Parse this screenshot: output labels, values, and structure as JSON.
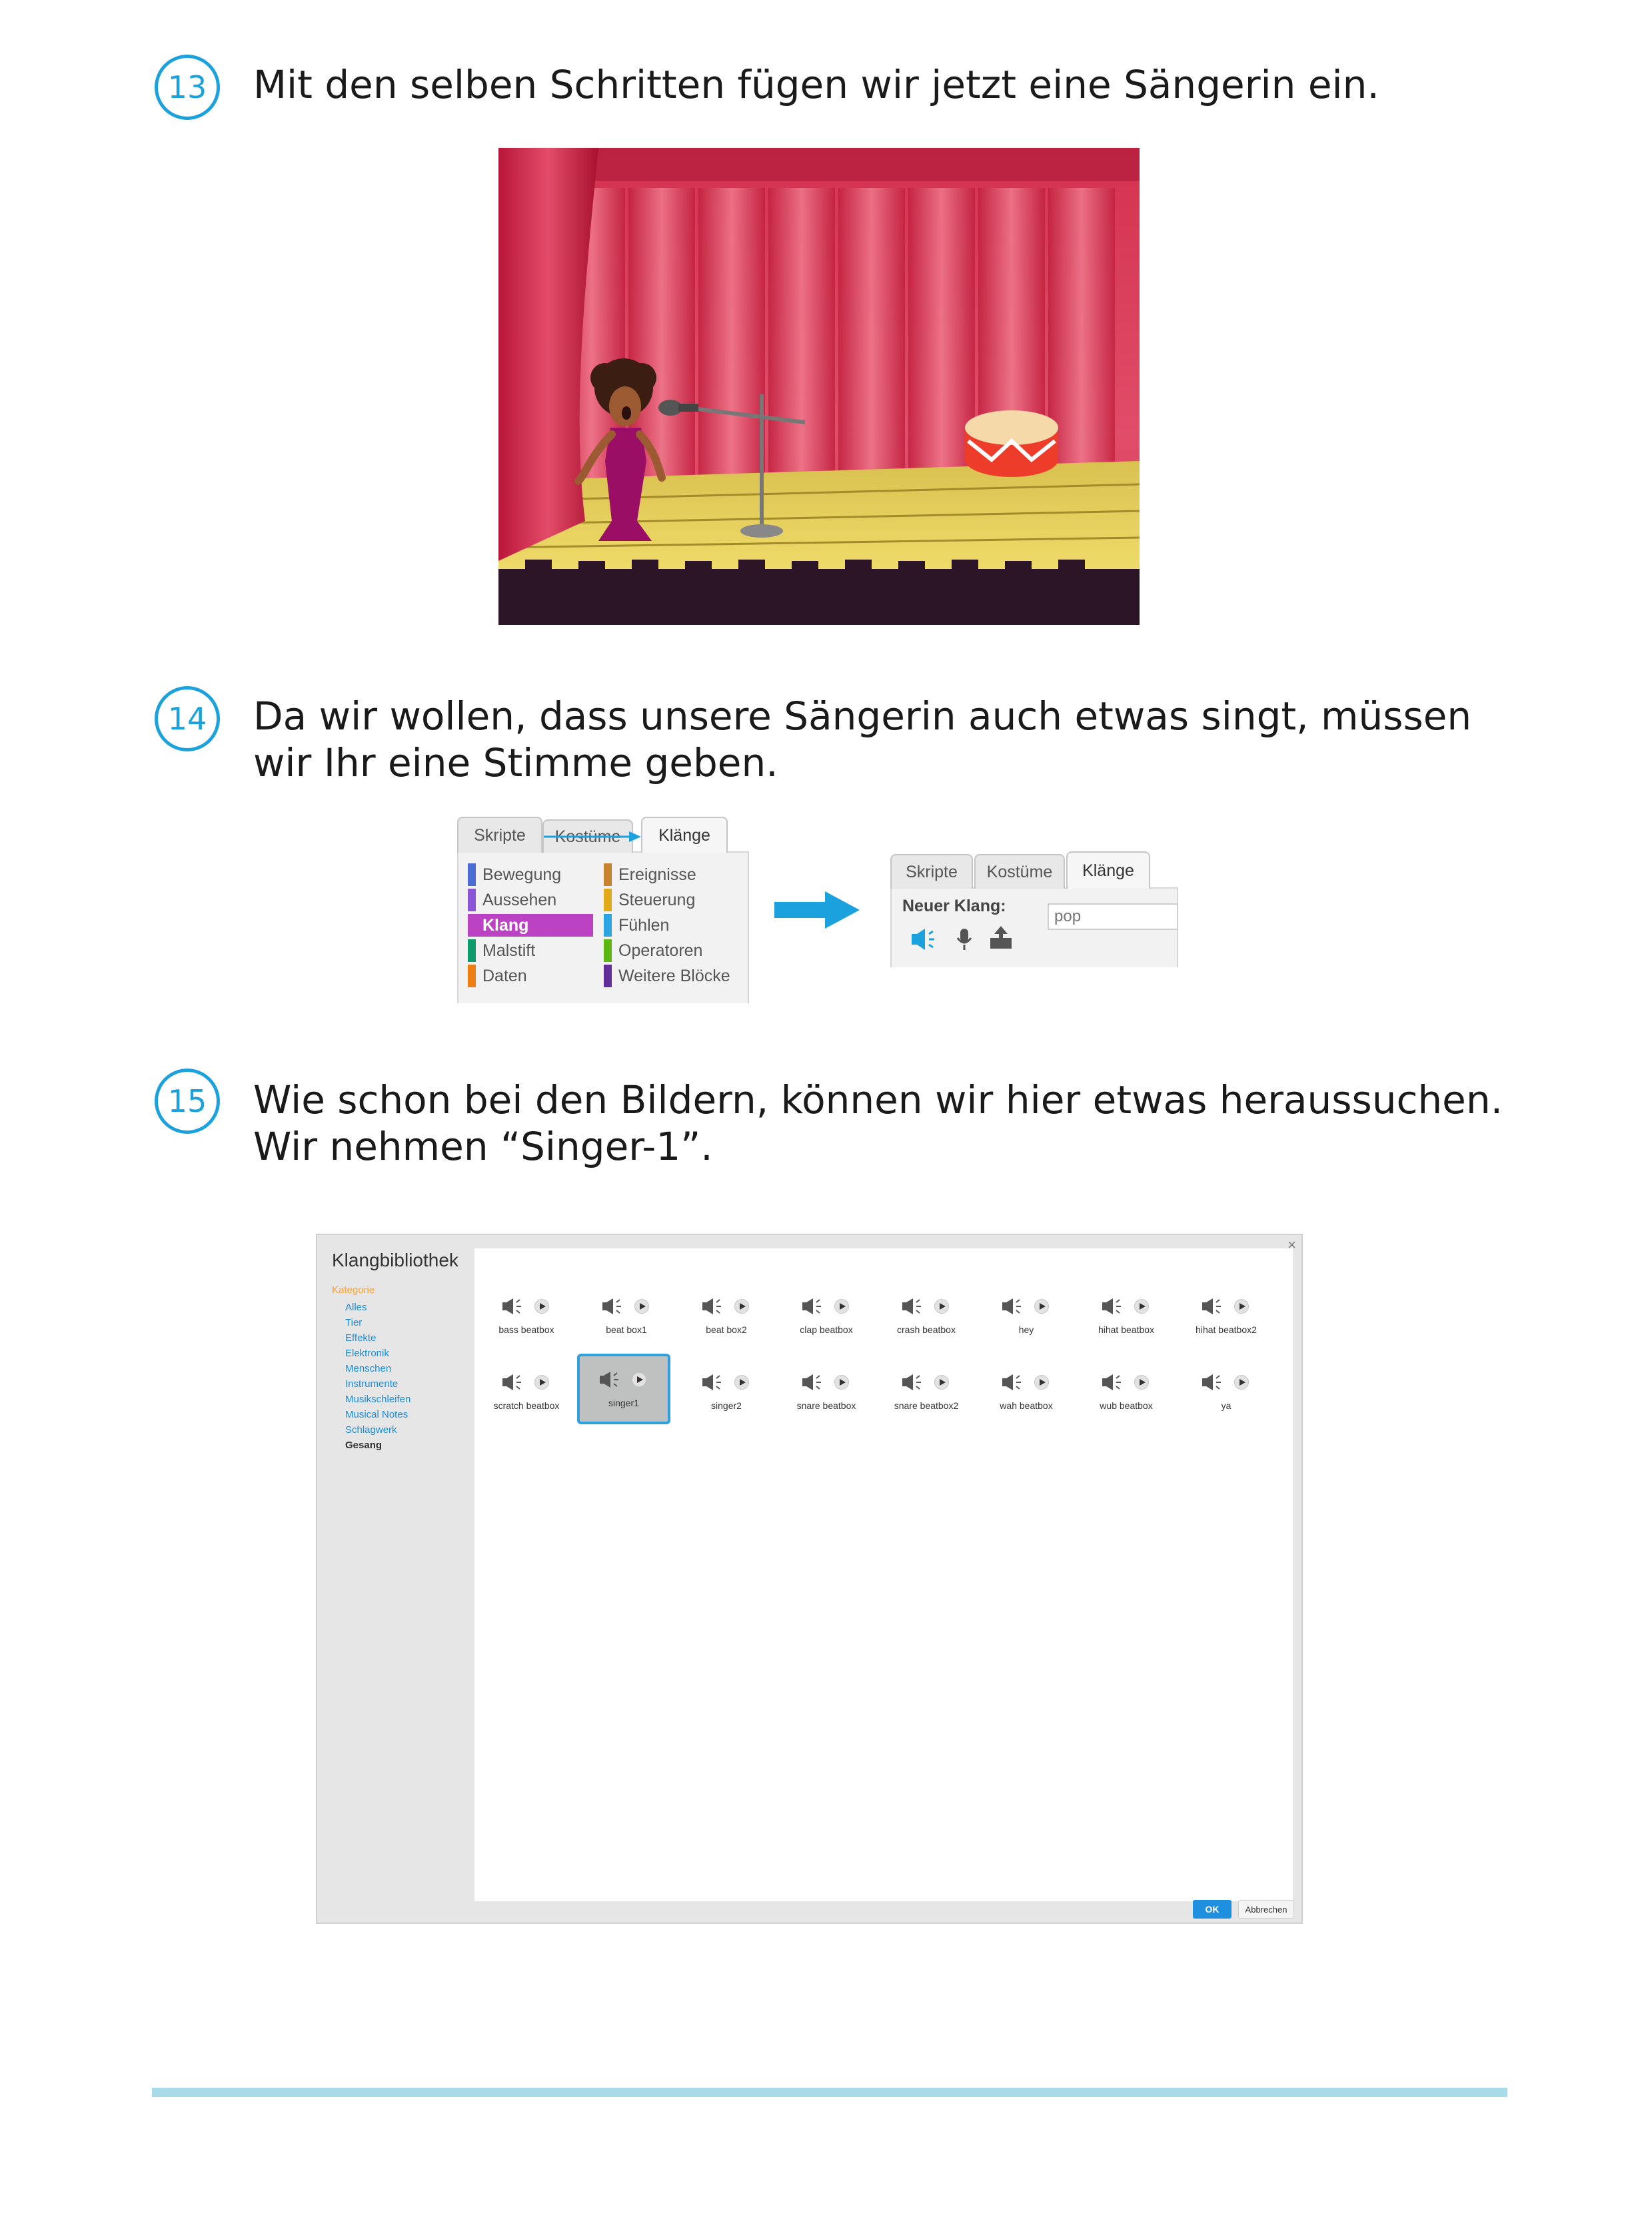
{
  "steps": [
    {
      "number": "13",
      "lines": [
        "Mit den selben Schritten fügen wir jetzt eine Sängerin ein."
      ]
    },
    {
      "number": "14",
      "lines": [
        "Da wir wollen, dass unsere Sängerin auch etwas singt, müssen",
        "wir Ihr eine Stimme geben."
      ]
    },
    {
      "number": "15",
      "lines": [
        "Wie schon bei den Bildern, können wir hier etwas heraussuchen.",
        "Wir nehmen “Singer-1”."
      ]
    }
  ],
  "panel_left": {
    "tabs": [
      "Skripte",
      "Kostüme",
      "Klänge"
    ],
    "categories_left": [
      "Bewegung",
      "Aussehen",
      "Klang",
      "Malstift",
      "Daten"
    ],
    "categories_right": [
      "Ereignisse",
      "Steuerung",
      "Fühlen",
      "Operatoren",
      "Weitere Blöcke"
    ],
    "selected": "Klang",
    "category_colors": [
      "#4a6cd4",
      "#8a55d7",
      "#bb42c3",
      "#0e9a6c",
      "#ee7d16",
      "#c88330",
      "#e1a91a",
      "#2ca5e2",
      "#5cb712",
      "#632d99"
    ]
  },
  "panel_right": {
    "tabs": [
      "Skripte",
      "Kostüme",
      "Klänge"
    ],
    "new_sound_label": "Neuer Klang:",
    "sound_name": "pop"
  },
  "library": {
    "title": "Klangbibliothek",
    "close": "×",
    "category_heading": "Kategorie",
    "categories": [
      "Alles",
      "Tier",
      "Effekte",
      "Elektronik",
      "Menschen",
      "Instrumente",
      "Musikschleifen",
      "Musical Notes",
      "Schlagwerk",
      "Gesang"
    ],
    "selected_category": "Gesang",
    "sounds": [
      "bass beatbox",
      "beat box1",
      "beat box2",
      "clap beatbox",
      "crash beatbox",
      "hey",
      "hihat beatbox",
      "hihat beatbox2",
      "scratch beatbox",
      "singer1",
      "singer2",
      "snare beatbox",
      "snare beatbox2",
      "wah beatbox",
      "wub beatbox",
      "ya"
    ],
    "selected_sound": "singer1",
    "ok": "OK",
    "cancel": "Abbrechen"
  },
  "colors": {
    "accent": "#1ba1dc",
    "footer_line": "#a9dae9"
  }
}
